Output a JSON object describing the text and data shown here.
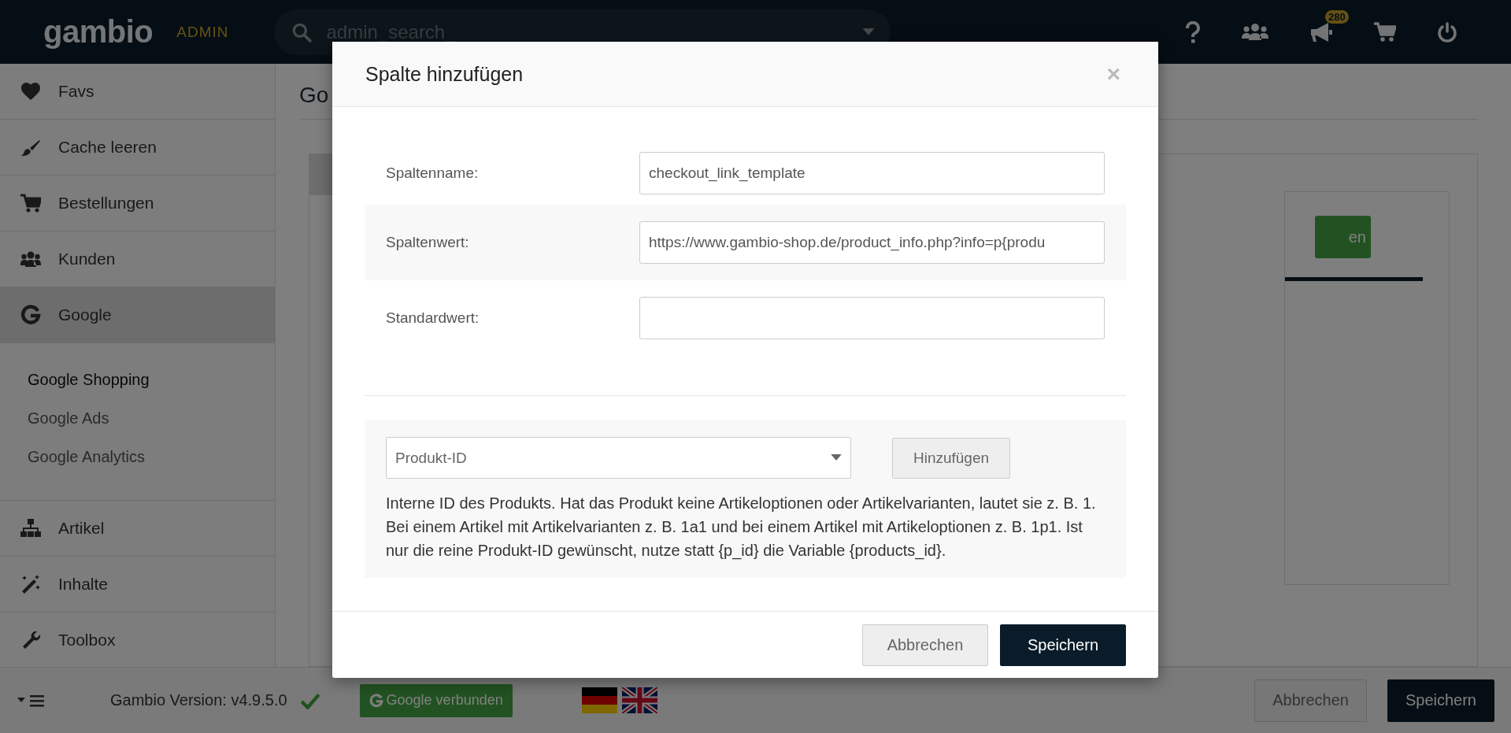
{
  "header": {
    "logo": "gambio",
    "badge": "ADMIN",
    "search": {
      "placeholder": "admin_search_"
    },
    "notification_count": "280"
  },
  "sidebar": {
    "items": [
      {
        "label": "Favs",
        "selected": false
      },
      {
        "label": "Cache leeren",
        "selected": false
      },
      {
        "label": "Bestellungen",
        "selected": false
      },
      {
        "label": "Kunden",
        "selected": false
      },
      {
        "label": "Google",
        "selected": true,
        "children": [
          {
            "label": "Google Shopping",
            "selected": true
          },
          {
            "label": "Google Ads",
            "selected": false
          },
          {
            "label": "Google Analytics",
            "selected": false
          }
        ]
      },
      {
        "label": "Artikel",
        "selected": false
      },
      {
        "label": "Inhalte",
        "selected": false
      },
      {
        "label": "Toolbox",
        "selected": false
      }
    ]
  },
  "page": {
    "title": "Go",
    "button": "en"
  },
  "footer": {
    "version": "Gambio Version: v4.9.5.0",
    "google_button": "Google verbunden",
    "buttons": [
      "Abbrechen",
      "Speichern"
    ]
  },
  "modal": {
    "title": "Spalte hinzufügen",
    "close": "×",
    "fields": [
      {
        "label": "Spaltenname:",
        "value": "checkout_link_template"
      },
      {
        "label": "Spaltenwert:",
        "value": "https://www.gambio-shop.de/product_info.php?info=p{produ"
      },
      {
        "label": "Standardwert:"
      }
    ],
    "variable_select": {
      "value": "Produkt-ID"
    },
    "add_button": "Hinzufügen",
    "description": "Interne ID des Produkts. Hat das Produkt keine Artikeloptionen oder Artikelvarianten, lautet sie z. B. 1. Bei einem Artikel mit Artikelvarianten z. B. 1a1 und bei einem Artikel mit Artikeloptionen z. B. 1p1. Ist nur die reine Produkt-ID gewünscht, nutze statt {p_id} die Variable {products_id}.",
    "buttons": [
      "Abbrechen",
      "Speichern"
    ]
  }
}
